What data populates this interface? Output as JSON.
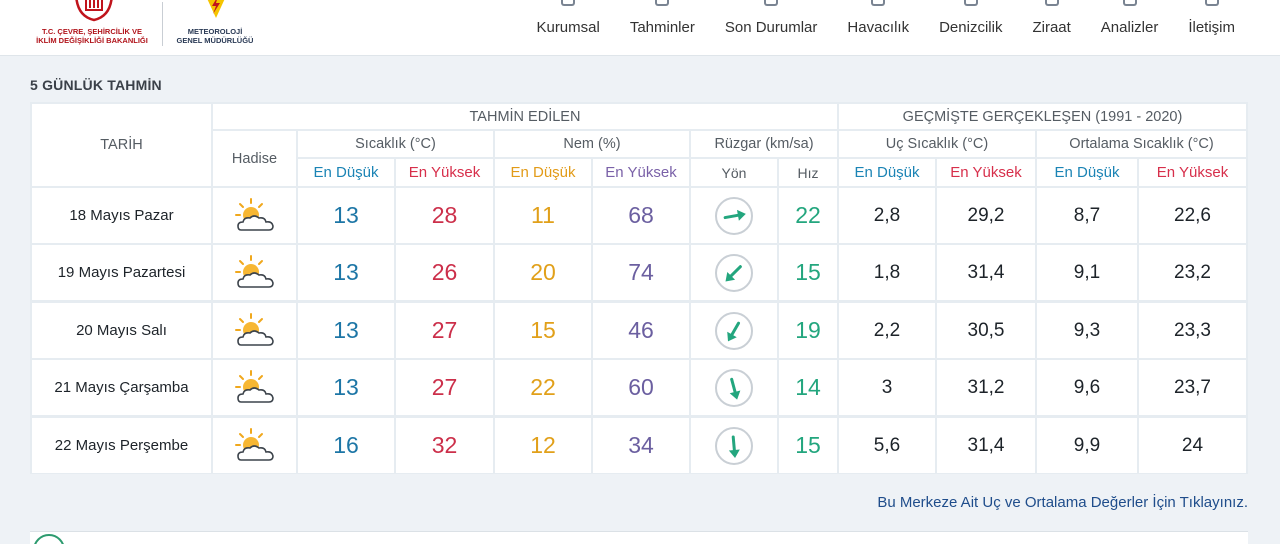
{
  "header": {
    "ministry_name_line1": "T.C. ÇEVRE, ŞEHİRCİLİK VE",
    "ministry_name_line2": "İKLİM DEĞİŞİKLİĞİ BAKANLIĞI",
    "mgm_name_line1": "METEOROLOJİ",
    "mgm_name_line2": "GENEL MÜDÜRLÜĞÜ",
    "nav": [
      "Kurumsal",
      "Tahminler",
      "Son Durumlar",
      "Havacılık",
      "Denizcilik",
      "Ziraat",
      "Analizler",
      "İletişim"
    ]
  },
  "section_title": "5 GÜNLÜK TAHMİN",
  "table": {
    "col_tarih": "TARİH",
    "group_forecast": "TAHMİN EDİLEN",
    "group_past": "GEÇMİŞTE GERÇEKLEŞEN (1991 - 2020)",
    "col_hadise": "Hadise",
    "col_sicaklik": "Sıcaklık (°C)",
    "col_nem": "Nem (%)",
    "col_ruzgar": "Rüzgar (km/sa)",
    "col_uc": "Uç Sıcaklık (°C)",
    "col_ortalama": "Ortalama Sıcaklık (°C)",
    "sub_low": "En Düşük",
    "sub_high": "En Yüksek",
    "sub_yon": "Yön",
    "sub_hiz": "Hız",
    "rows": [
      {
        "date": "18 Mayıs Pazar",
        "weather_icon": "partly-cloudy-icon",
        "temp_low": "13",
        "temp_high": "28",
        "hum_low": "11",
        "hum_high": "68",
        "wind_dir_deg": 80,
        "wind_speed": "22",
        "ext_low": "2,8",
        "ext_high": "29,2",
        "avg_low": "8,7",
        "avg_high": "22,6"
      },
      {
        "date": "19 Mayıs Pazartesi",
        "weather_icon": "partly-cloudy-icon",
        "temp_low": "13",
        "temp_high": "26",
        "hum_low": "20",
        "hum_high": "74",
        "wind_dir_deg": 225,
        "wind_speed": "15",
        "ext_low": "1,8",
        "ext_high": "31,4",
        "avg_low": "9,1",
        "avg_high": "23,2"
      },
      {
        "date": "20 Mayıs Salı",
        "weather_icon": "partly-cloudy-icon",
        "temp_low": "13",
        "temp_high": "27",
        "hum_low": "15",
        "hum_high": "46",
        "wind_dir_deg": 210,
        "wind_speed": "19",
        "ext_low": "2,2",
        "ext_high": "30,5",
        "avg_low": "9,3",
        "avg_high": "23,3"
      },
      {
        "date": "21 Mayıs Çarşamba",
        "weather_icon": "partly-cloudy-icon",
        "temp_low": "13",
        "temp_high": "27",
        "hum_low": "22",
        "hum_high": "60",
        "wind_dir_deg": 165,
        "wind_speed": "14",
        "ext_low": "3",
        "ext_high": "31,2",
        "avg_low": "9,6",
        "avg_high": "23,7"
      },
      {
        "date": "22 Mayıs Perşembe",
        "weather_icon": "partly-cloudy-icon",
        "temp_low": "16",
        "temp_high": "32",
        "hum_low": "12",
        "hum_high": "34",
        "wind_dir_deg": 175,
        "wind_speed": "15",
        "ext_low": "5,6",
        "ext_high": "31,4",
        "avg_low": "9,9",
        "avg_high": "24"
      }
    ]
  },
  "footer_link": "Bu Merkeze Ait Uç ve Ortalama Değerler İçin Tıklayınız.",
  "colors": {
    "low": "#1b84b5",
    "high": "#d72f4b",
    "hum_low": "#e29b18",
    "hum_high": "#7a61a8",
    "wind": "#23a67e",
    "link": "#1f4d8b"
  }
}
